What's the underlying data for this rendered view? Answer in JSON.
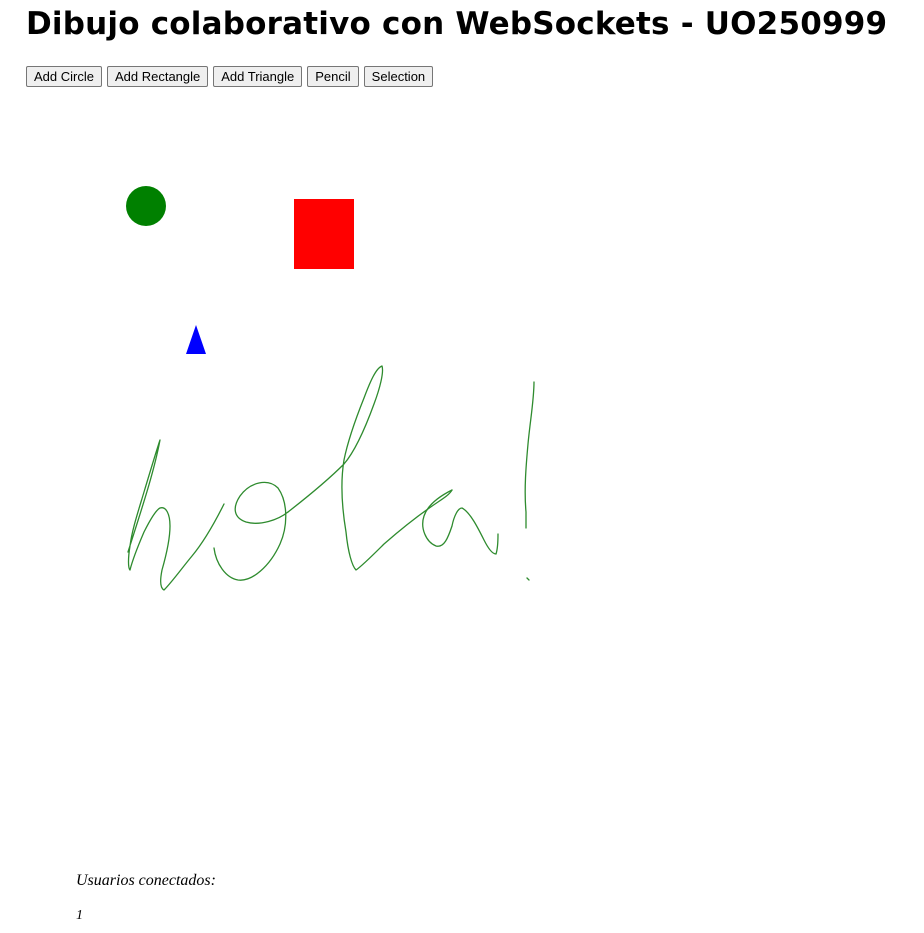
{
  "page": {
    "title": "Dibujo colaborativo con WebSockets - UO250999"
  },
  "toolbar": {
    "buttons": [
      {
        "label": "Add Circle"
      },
      {
        "label": "Add Rectangle"
      },
      {
        "label": "Add Triangle"
      },
      {
        "label": "Pencil"
      },
      {
        "label": "Selection"
      }
    ]
  },
  "canvas": {
    "shapes": [
      {
        "kind": "circle",
        "color": "#008000"
      },
      {
        "kind": "rectangle",
        "color": "#ff0000"
      },
      {
        "kind": "triangle",
        "color": "#0000ff"
      }
    ],
    "pencil_stroke": {
      "color": "#2e8b2e"
    }
  },
  "users": {
    "label": "Usuarios conectados:",
    "count": "1"
  }
}
